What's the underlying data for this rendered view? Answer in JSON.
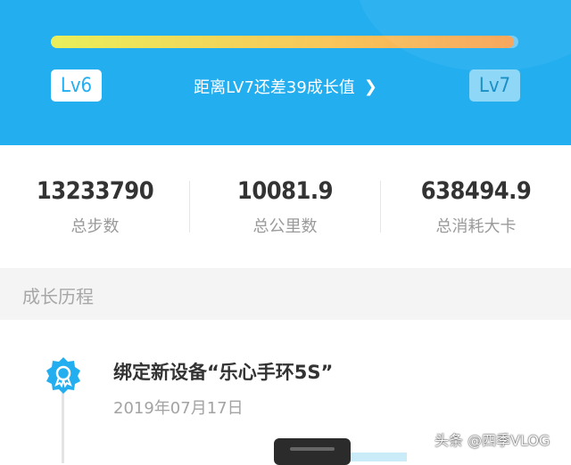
{
  "level": {
    "current": "Lv6",
    "next": "Lv7",
    "hint": "距离LV7还差39成长值",
    "progress_fraction": 0.99
  },
  "stats": [
    {
      "value": "13233790",
      "label": "总步数"
    },
    {
      "value": "10081.9",
      "label": "总公里数"
    },
    {
      "value": "638494.9",
      "label": "总消耗大卡"
    }
  ],
  "section": {
    "title": "成长历程"
  },
  "timeline": [
    {
      "title": "绑定新设备“乐心手环5S”",
      "date": "2019年07月17日",
      "icon": "medal-icon"
    }
  ],
  "watermark": "头条 @四季VLOG",
  "colors": {
    "header": "#23aef0",
    "progress_start": "#e9ef5a",
    "progress_end": "#f7a254"
  }
}
